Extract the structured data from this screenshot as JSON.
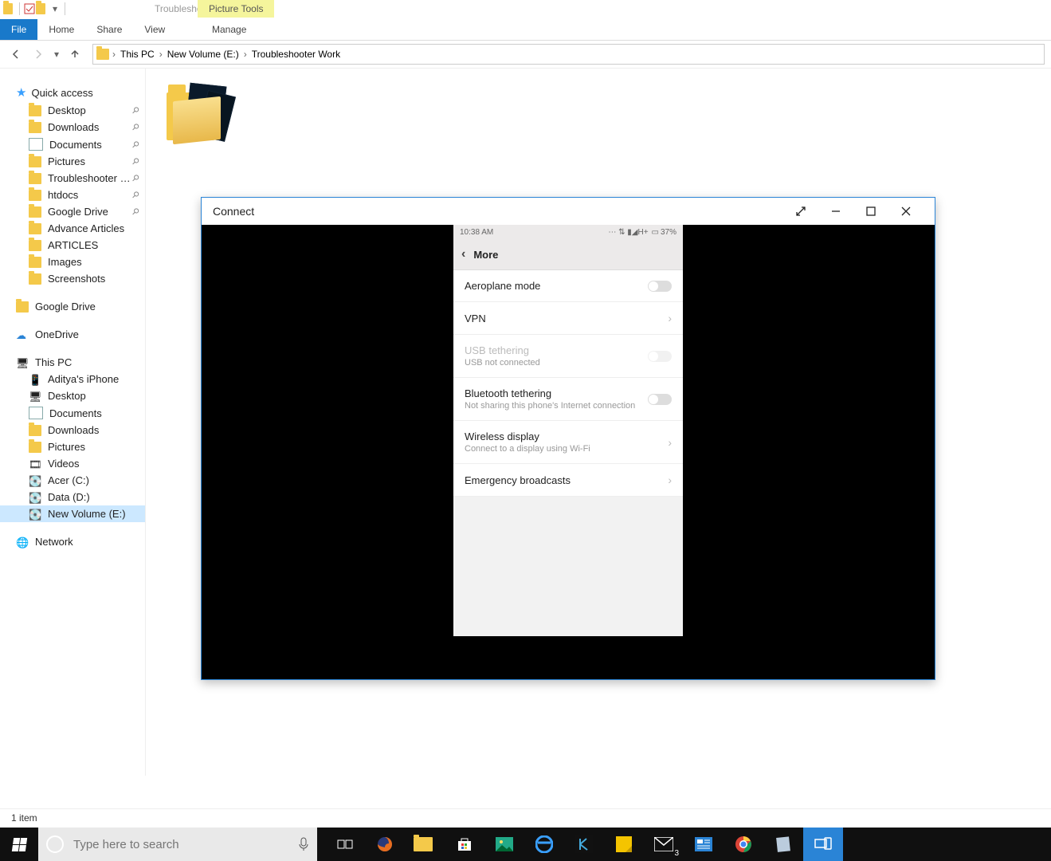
{
  "titlebar": {
    "picture_tools": "Picture Tools",
    "window_title": "Troubleshooter Work"
  },
  "ribbon": {
    "file": "File",
    "home": "Home",
    "share": "Share",
    "view": "View",
    "manage": "Manage"
  },
  "breadcrumb": {
    "this_pc": "This PC",
    "volume": "New Volume (E:)",
    "folder": "Troubleshooter Work"
  },
  "sidebar": {
    "quick_access": "Quick access",
    "qa": {
      "desktop": "Desktop",
      "downloads": "Downloads",
      "documents": "Documents",
      "pictures": "Pictures",
      "troubleshooter": "Troubleshooter W…",
      "htdocs": "htdocs",
      "gdrive": "Google Drive",
      "advance": "Advance Articles",
      "articles": "ARTICLES",
      "images": "Images",
      "screenshots": "Screenshots"
    },
    "gdrive_root": "Google Drive",
    "onedrive": "OneDrive",
    "this_pc": "This PC",
    "pc": {
      "iphone": "Aditya's iPhone",
      "desktop": "Desktop",
      "documents": "Documents",
      "downloads": "Downloads",
      "pictures": "Pictures",
      "videos": "Videos",
      "acer": "Acer (C:)",
      "data": "Data (D:)",
      "newvol": "New Volume (E:)"
    },
    "network": "Network"
  },
  "connect": {
    "title": "Connect",
    "phone": {
      "time": "10:38 AM",
      "signal": "H+",
      "battery": "37%",
      "header": "More",
      "rows": {
        "airplane": "Aeroplane mode",
        "vpn": "VPN",
        "usb_title": "USB tethering",
        "usb_sub": "USB not connected",
        "bt_title": "Bluetooth tethering",
        "bt_sub": "Not sharing this phone's Internet connection",
        "wd_title": "Wireless display",
        "wd_sub": "Connect to a display using Wi-Fi",
        "emergency": "Emergency broadcasts"
      }
    }
  },
  "status": {
    "items": "1 item"
  },
  "taskbar": {
    "search_placeholder": "Type here to search",
    "mail_badge": "3"
  }
}
